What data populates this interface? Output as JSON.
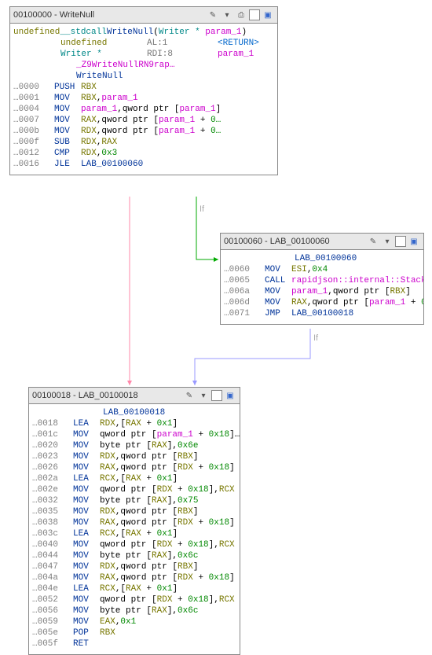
{
  "nodes": {
    "main": {
      "title": "00100000 - WriteNull",
      "sig_pre": "undefined",
      "sig_cc": "__stdcall",
      "sig_name": "WriteNull",
      "sig_params_open": "(",
      "sig_params_type": "Writer *",
      "sig_params_name": "param_1",
      "sig_params_close": ")",
      "row1_type": "undefined",
      "row1_reg": "AL:1",
      "row1_tag": "<RETURN>",
      "row2_type": "Writer *",
      "row2_reg": "RDI:8",
      "row2_tag": "param_1",
      "mangled": "_Z9WriteNullRN9rap…",
      "demangled": "WriteNull",
      "lines": [
        {
          "addr": "…0000",
          "mn": "PUSH",
          "ops": [
            {
              "t": "reg",
              "v": "RBX"
            }
          ]
        },
        {
          "addr": "…0001",
          "mn": "MOV",
          "ops": [
            {
              "t": "reg",
              "v": "RBX"
            },
            {
              "t": "txt",
              "v": ","
            },
            {
              "t": "var",
              "v": "param_1"
            }
          ]
        },
        {
          "addr": "…0004",
          "mn": "MOV",
          "ops": [
            {
              "t": "var",
              "v": "param_1"
            },
            {
              "t": "txt",
              "v": ",qword ptr ["
            },
            {
              "t": "var",
              "v": "param_1"
            },
            {
              "t": "txt",
              "v": "]"
            }
          ]
        },
        {
          "addr": "…0007",
          "mn": "MOV",
          "ops": [
            {
              "t": "reg",
              "v": "RAX"
            },
            {
              "t": "txt",
              "v": ",qword ptr ["
            },
            {
              "t": "var",
              "v": "param_1"
            },
            {
              "t": "txt",
              "v": " + "
            },
            {
              "t": "num",
              "v": "0…"
            }
          ]
        },
        {
          "addr": "…000b",
          "mn": "MOV",
          "ops": [
            {
              "t": "reg",
              "v": "RDX"
            },
            {
              "t": "txt",
              "v": ",qword ptr ["
            },
            {
              "t": "var",
              "v": "param_1"
            },
            {
              "t": "txt",
              "v": " + "
            },
            {
              "t": "num",
              "v": "0…"
            }
          ]
        },
        {
          "addr": "…000f",
          "mn": "SUB",
          "ops": [
            {
              "t": "reg",
              "v": "RDX"
            },
            {
              "t": "txt",
              "v": ","
            },
            {
              "t": "reg",
              "v": "RAX"
            }
          ]
        },
        {
          "addr": "…0012",
          "mn": "CMP",
          "ops": [
            {
              "t": "reg",
              "v": "RDX"
            },
            {
              "t": "txt",
              "v": ","
            },
            {
              "t": "num",
              "v": "0x3"
            }
          ]
        },
        {
          "addr": "…0016",
          "mn": "JLE",
          "ops": [
            {
              "t": "lab",
              "v": "LAB_00100060"
            }
          ]
        }
      ]
    },
    "right": {
      "title": "00100060 - LAB_00100060",
      "label": "LAB_00100060",
      "lines": [
        {
          "addr": "…0060",
          "mn": "MOV",
          "ops": [
            {
              "t": "reg",
              "v": "ESI"
            },
            {
              "t": "txt",
              "v": ","
            },
            {
              "t": "num",
              "v": "0x4"
            }
          ]
        },
        {
          "addr": "…0065",
          "mn": "CALL",
          "ops": [
            {
              "t": "pink",
              "v": "rapidjson::internal::Stack"
            }
          ]
        },
        {
          "addr": "…006a",
          "mn": "MOV",
          "ops": [
            {
              "t": "var",
              "v": "param_1"
            },
            {
              "t": "txt",
              "v": ",qword ptr ["
            },
            {
              "t": "reg",
              "v": "RBX"
            },
            {
              "t": "txt",
              "v": "]"
            }
          ]
        },
        {
          "addr": "…006d",
          "mn": "MOV",
          "ops": [
            {
              "t": "reg",
              "v": "RAX"
            },
            {
              "t": "txt",
              "v": ",qword ptr ["
            },
            {
              "t": "var",
              "v": "param_1"
            },
            {
              "t": "txt",
              "v": " + "
            },
            {
              "t": "num",
              "v": "0…"
            }
          ]
        },
        {
          "addr": "…0071",
          "mn": "JMP",
          "ops": [
            {
              "t": "lab",
              "v": "LAB_00100018"
            }
          ]
        }
      ]
    },
    "bottom": {
      "title": "00100018 - LAB_00100018",
      "label": "LAB_00100018",
      "lines": [
        {
          "addr": "…0018",
          "mn": "LEA",
          "ops": [
            {
              "t": "reg",
              "v": "RDX"
            },
            {
              "t": "txt",
              "v": ",["
            },
            {
              "t": "reg",
              "v": "RAX"
            },
            {
              "t": "txt",
              "v": " + "
            },
            {
              "t": "num",
              "v": "0x1"
            },
            {
              "t": "txt",
              "v": "]"
            }
          ]
        },
        {
          "addr": "…001c",
          "mn": "MOV",
          "ops": [
            {
              "t": "txt",
              "v": "qword ptr ["
            },
            {
              "t": "var",
              "v": "param_1"
            },
            {
              "t": "txt",
              "v": " + "
            },
            {
              "t": "num",
              "v": "0x18"
            },
            {
              "t": "txt",
              "v": "]…"
            }
          ]
        },
        {
          "addr": "…0020",
          "mn": "MOV",
          "ops": [
            {
              "t": "txt",
              "v": "byte ptr ["
            },
            {
              "t": "reg",
              "v": "RAX"
            },
            {
              "t": "txt",
              "v": "],"
            },
            {
              "t": "num",
              "v": "0x6e"
            }
          ]
        },
        {
          "addr": "…0023",
          "mn": "MOV",
          "ops": [
            {
              "t": "reg",
              "v": "RDX"
            },
            {
              "t": "txt",
              "v": ",qword ptr ["
            },
            {
              "t": "reg",
              "v": "RBX"
            },
            {
              "t": "txt",
              "v": "]"
            }
          ]
        },
        {
          "addr": "…0026",
          "mn": "MOV",
          "ops": [
            {
              "t": "reg",
              "v": "RAX"
            },
            {
              "t": "txt",
              "v": ",qword ptr ["
            },
            {
              "t": "reg",
              "v": "RDX"
            },
            {
              "t": "txt",
              "v": " + "
            },
            {
              "t": "num",
              "v": "0x18"
            },
            {
              "t": "txt",
              "v": "]"
            }
          ]
        },
        {
          "addr": "…002a",
          "mn": "LEA",
          "ops": [
            {
              "t": "reg",
              "v": "RCX"
            },
            {
              "t": "txt",
              "v": ",["
            },
            {
              "t": "reg",
              "v": "RAX"
            },
            {
              "t": "txt",
              "v": " + "
            },
            {
              "t": "num",
              "v": "0x1"
            },
            {
              "t": "txt",
              "v": "]"
            }
          ]
        },
        {
          "addr": "…002e",
          "mn": "MOV",
          "ops": [
            {
              "t": "txt",
              "v": "qword ptr ["
            },
            {
              "t": "reg",
              "v": "RDX"
            },
            {
              "t": "txt",
              "v": " + "
            },
            {
              "t": "num",
              "v": "0x18"
            },
            {
              "t": "txt",
              "v": "],"
            },
            {
              "t": "reg",
              "v": "RCX"
            }
          ]
        },
        {
          "addr": "…0032",
          "mn": "MOV",
          "ops": [
            {
              "t": "txt",
              "v": "byte ptr ["
            },
            {
              "t": "reg",
              "v": "RAX"
            },
            {
              "t": "txt",
              "v": "],"
            },
            {
              "t": "num",
              "v": "0x75"
            }
          ]
        },
        {
          "addr": "…0035",
          "mn": "MOV",
          "ops": [
            {
              "t": "reg",
              "v": "RDX"
            },
            {
              "t": "txt",
              "v": ",qword ptr ["
            },
            {
              "t": "reg",
              "v": "RBX"
            },
            {
              "t": "txt",
              "v": "]"
            }
          ]
        },
        {
          "addr": "…0038",
          "mn": "MOV",
          "ops": [
            {
              "t": "reg",
              "v": "RAX"
            },
            {
              "t": "txt",
              "v": ",qword ptr ["
            },
            {
              "t": "reg",
              "v": "RDX"
            },
            {
              "t": "txt",
              "v": " + "
            },
            {
              "t": "num",
              "v": "0x18"
            },
            {
              "t": "txt",
              "v": "]"
            }
          ]
        },
        {
          "addr": "…003c",
          "mn": "LEA",
          "ops": [
            {
              "t": "reg",
              "v": "RCX"
            },
            {
              "t": "txt",
              "v": ",["
            },
            {
              "t": "reg",
              "v": "RAX"
            },
            {
              "t": "txt",
              "v": " + "
            },
            {
              "t": "num",
              "v": "0x1"
            },
            {
              "t": "txt",
              "v": "]"
            }
          ]
        },
        {
          "addr": "…0040",
          "mn": "MOV",
          "ops": [
            {
              "t": "txt",
              "v": "qword ptr ["
            },
            {
              "t": "reg",
              "v": "RDX"
            },
            {
              "t": "txt",
              "v": " + "
            },
            {
              "t": "num",
              "v": "0x18"
            },
            {
              "t": "txt",
              "v": "],"
            },
            {
              "t": "reg",
              "v": "RCX"
            }
          ]
        },
        {
          "addr": "…0044",
          "mn": "MOV",
          "ops": [
            {
              "t": "txt",
              "v": "byte ptr ["
            },
            {
              "t": "reg",
              "v": "RAX"
            },
            {
              "t": "txt",
              "v": "],"
            },
            {
              "t": "num",
              "v": "0x6c"
            }
          ]
        },
        {
          "addr": "…0047",
          "mn": "MOV",
          "ops": [
            {
              "t": "reg",
              "v": "RDX"
            },
            {
              "t": "txt",
              "v": ",qword ptr ["
            },
            {
              "t": "reg",
              "v": "RBX"
            },
            {
              "t": "txt",
              "v": "]"
            }
          ]
        },
        {
          "addr": "…004a",
          "mn": "MOV",
          "ops": [
            {
              "t": "reg",
              "v": "RAX"
            },
            {
              "t": "txt",
              "v": ",qword ptr ["
            },
            {
              "t": "reg",
              "v": "RDX"
            },
            {
              "t": "txt",
              "v": " + "
            },
            {
              "t": "num",
              "v": "0x18"
            },
            {
              "t": "txt",
              "v": "]"
            }
          ]
        },
        {
          "addr": "…004e",
          "mn": "LEA",
          "ops": [
            {
              "t": "reg",
              "v": "RCX"
            },
            {
              "t": "txt",
              "v": ",["
            },
            {
              "t": "reg",
              "v": "RAX"
            },
            {
              "t": "txt",
              "v": " + "
            },
            {
              "t": "num",
              "v": "0x1"
            },
            {
              "t": "txt",
              "v": "]"
            }
          ]
        },
        {
          "addr": "…0052",
          "mn": "MOV",
          "ops": [
            {
              "t": "txt",
              "v": "qword ptr ["
            },
            {
              "t": "reg",
              "v": "RDX"
            },
            {
              "t": "txt",
              "v": " + "
            },
            {
              "t": "num",
              "v": "0x18"
            },
            {
              "t": "txt",
              "v": "],"
            },
            {
              "t": "reg",
              "v": "RCX"
            }
          ]
        },
        {
          "addr": "…0056",
          "mn": "MOV",
          "ops": [
            {
              "t": "txt",
              "v": "byte ptr ["
            },
            {
              "t": "reg",
              "v": "RAX"
            },
            {
              "t": "txt",
              "v": "],"
            },
            {
              "t": "num",
              "v": "0x6c"
            }
          ]
        },
        {
          "addr": "…0059",
          "mn": "MOV",
          "ops": [
            {
              "t": "reg",
              "v": "EAX"
            },
            {
              "t": "txt",
              "v": ","
            },
            {
              "t": "num",
              "v": "0x1"
            }
          ]
        },
        {
          "addr": "…005e",
          "mn": "POP",
          "ops": [
            {
              "t": "reg",
              "v": "RBX"
            }
          ]
        },
        {
          "addr": "…005f",
          "mn": "RET",
          "ops": []
        }
      ]
    }
  },
  "edge_labels": {
    "if1": "If",
    "if2": "If"
  }
}
